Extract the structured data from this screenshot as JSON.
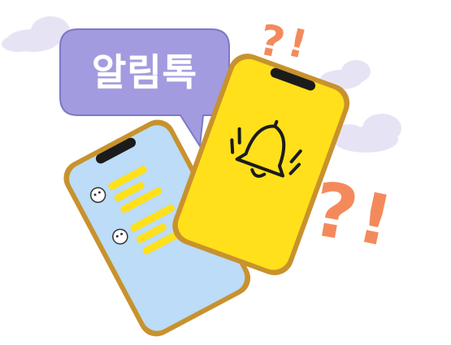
{
  "bubble": {
    "label": "알림톡"
  },
  "icons": {
    "bell": "bell-icon",
    "marks": [
      "question-exclamation-small",
      "question-exclamation-large"
    ],
    "avatars": [
      "chat-avatar-icon",
      "chat-avatar-icon"
    ]
  },
  "colors": {
    "bubble": "#a29be0",
    "bubble_border": "#7e78c9",
    "phone_gold": "#c8922d",
    "screen_blue": "#bcdcf7",
    "screen_yellow": "#ffe01a",
    "chat_bar": "#ffe01a",
    "cloud": "#e6e4f4",
    "question_mark": "#f48a5b"
  }
}
